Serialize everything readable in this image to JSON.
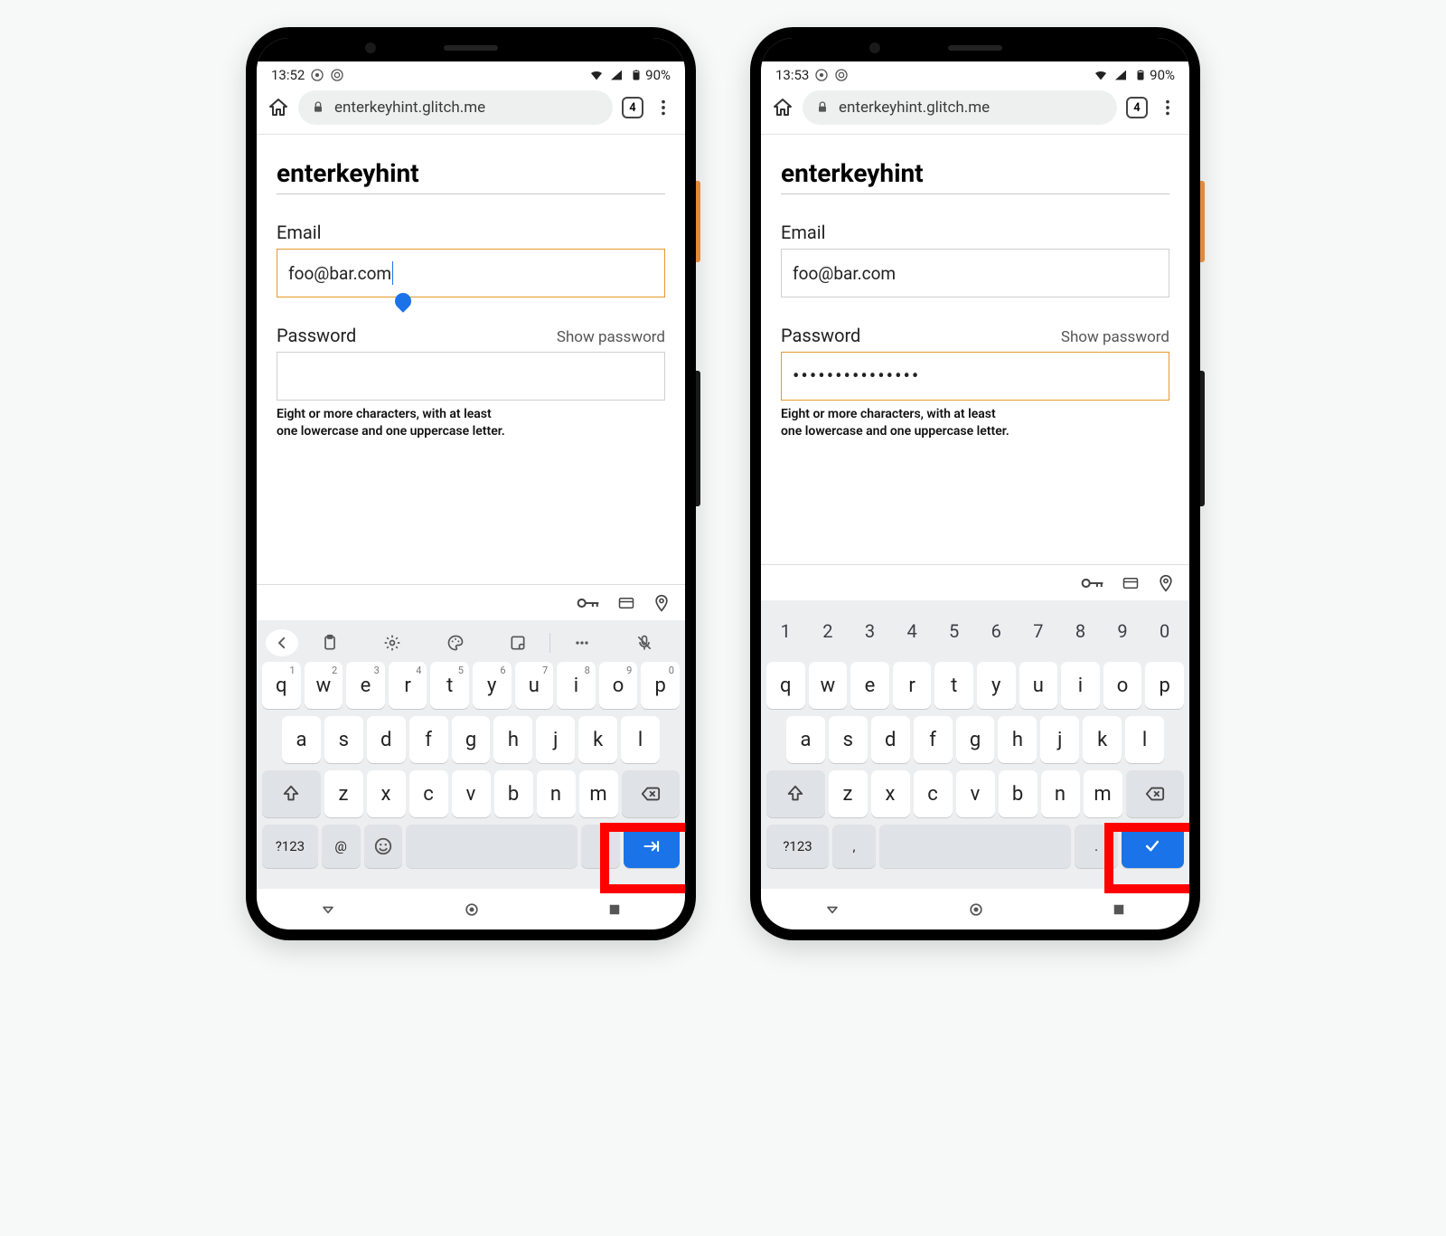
{
  "phones": [
    {
      "status": {
        "time": "13:52",
        "battery": "90%"
      },
      "browser": {
        "url": "enterkeyhint.glitch.me",
        "tab_count": "4"
      },
      "page": {
        "title": "enterkeyhint",
        "email_label": "Email",
        "email_value": "foo@bar.com",
        "password_label": "Password",
        "show_password": "Show password",
        "password_value": "",
        "hint_line1": "Eight or more characters, with at least",
        "hint_line2": "one lowercase and one uppercase letter.",
        "email_focused": true,
        "password_focused": false
      },
      "keyboard": {
        "show_num_row": false,
        "show_toolbar": true,
        "row1": [
          "q",
          "w",
          "e",
          "r",
          "t",
          "y",
          "u",
          "i",
          "o",
          "p"
        ],
        "row1_sup": [
          "1",
          "2",
          "3",
          "4",
          "5",
          "6",
          "7",
          "8",
          "9",
          "0"
        ],
        "row2": [
          "a",
          "s",
          "d",
          "f",
          "g",
          "h",
          "j",
          "k",
          "l"
        ],
        "row3": [
          "z",
          "x",
          "c",
          "v",
          "b",
          "n",
          "m"
        ],
        "bottom": {
          "mode": "?123",
          "alt1": "@",
          "alt2_is_emoji": true,
          "dot": ".",
          "enter_icon": "next"
        }
      }
    },
    {
      "status": {
        "time": "13:53",
        "battery": "90%"
      },
      "browser": {
        "url": "enterkeyhint.glitch.me",
        "tab_count": "4"
      },
      "page": {
        "title": "enterkeyhint",
        "email_label": "Email",
        "email_value": "foo@bar.com",
        "password_label": "Password",
        "show_password": "Show password",
        "password_value": "•••••••••••••••",
        "hint_line1": "Eight or more characters, with at least",
        "hint_line2": "one lowercase and one uppercase letter.",
        "email_focused": false,
        "password_focused": true
      },
      "keyboard": {
        "show_num_row": true,
        "show_toolbar": false,
        "num_row": [
          "1",
          "2",
          "3",
          "4",
          "5",
          "6",
          "7",
          "8",
          "9",
          "0"
        ],
        "row1": [
          "q",
          "w",
          "e",
          "r",
          "t",
          "y",
          "u",
          "i",
          "o",
          "p"
        ],
        "row1_sup": [],
        "row2": [
          "a",
          "s",
          "d",
          "f",
          "g",
          "h",
          "j",
          "k",
          "l"
        ],
        "row3": [
          "z",
          "x",
          "c",
          "v",
          "b",
          "n",
          "m"
        ],
        "bottom": {
          "mode": "?123",
          "alt1": ",",
          "alt2_is_emoji": false,
          "dot": ".",
          "enter_icon": "done"
        }
      }
    }
  ]
}
